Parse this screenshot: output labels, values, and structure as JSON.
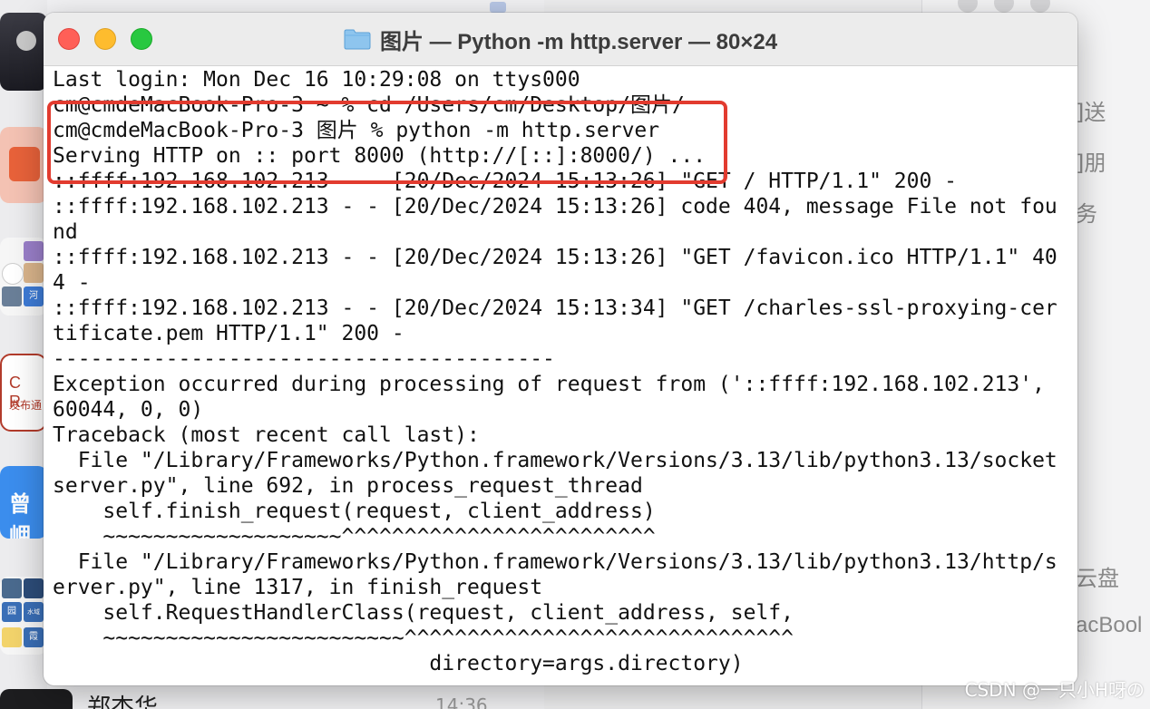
{
  "window": {
    "title": "图片 — Python -m http.server — 80×24",
    "title_icon": "folder-icon",
    "controls": [
      "close",
      "minimize",
      "zoom"
    ]
  },
  "terminal": {
    "lines": [
      "Last login: Mon Dec 16 10:29:08 on ttys000",
      "cm@cmdeMacBook-Pro-3 ~ % cd /Users/cm/Desktop/图片/",
      "cm@cmdeMacBook-Pro-3 图片 % python -m http.server",
      "Serving HTTP on :: port 8000 (http://[::]:8000/) ...",
      "::ffff:192.168.102.213 - - [20/Dec/2024 15:13:26] \"GET / HTTP/1.1\" 200 -",
      "::ffff:192.168.102.213 - - [20/Dec/2024 15:13:26] code 404, message File not fou",
      "nd",
      "::ffff:192.168.102.213 - - [20/Dec/2024 15:13:26] \"GET /favicon.ico HTTP/1.1\" 40",
      "4 -",
      "::ffff:192.168.102.213 - - [20/Dec/2024 15:13:34] \"GET /charles-ssl-proxying-cer",
      "tificate.pem HTTP/1.1\" 200 -",
      "----------------------------------------",
      "Exception occurred during processing of request from ('::ffff:192.168.102.213',",
      "60044, 0, 0)",
      "Traceback (most recent call last):",
      "  File \"/Library/Frameworks/Python.framework/Versions/3.13/lib/python3.13/socket",
      "server.py\", line 692, in process_request_thread",
      "    self.finish_request(request, client_address)",
      "    ~~~~~~~~~~~~~~~~~~~^^^^^^^^^^^^^^^^^^^^^^^^^",
      "  File \"/Library/Frameworks/Python.framework/Versions/3.13/lib/python3.13/http/s",
      "erver.py\", line 1317, in finish_request",
      "    self.RequestHandlerClass(request, client_address, self,",
      "    ~~~~~~~~~~~~~~~~~~~~~~~~^^^^^^^^^^^^^^^^^^^^^^^^^^^^^^^",
      "                              directory=args.directory)"
    ],
    "highlight_color": "#e23b2f"
  },
  "background": {
    "left_avatar_texts": {
      "cr": "C R",
      "cr_sub": "发布通",
      "blue": "曾岬",
      "tile_a": "河",
      "tile_b": "园",
      "tile_c": "水域",
      "tile_d": "霞"
    },
    "contact_name": "郑杰华",
    "contact_time": "14:36",
    "right_fragments": [
      "]送",
      "]朋",
      "务",
      "云盘",
      "acBool"
    ]
  },
  "watermark": "CSDN @一只小H呀の"
}
